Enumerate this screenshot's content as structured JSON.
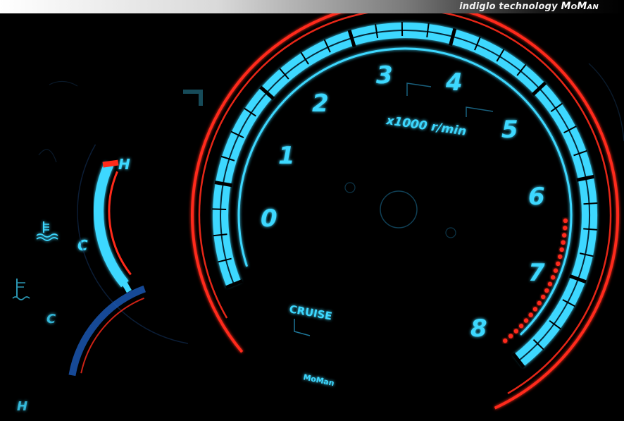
{
  "header": {
    "tagline": "indiglo technology",
    "brand": "MoMan"
  },
  "tachometer": {
    "numbers": [
      "0",
      "1",
      "2",
      "3",
      "4",
      "5",
      "6",
      "7",
      "8"
    ],
    "unit_label": "x1000 r/min",
    "cruise_label": "CRUISE",
    "brand_mark": "MoMan"
  },
  "temp_gauge": {
    "hot_label": "H",
    "cold_label": "C"
  },
  "fuel_gauge": {
    "cold_label": "C",
    "hot_label": "H"
  },
  "colors": {
    "backlight": "#3ed8ff",
    "redline": "#ff2a1a",
    "background": "#000000"
  },
  "icons": [
    "coolant-temp-icon",
    "fuel-icon"
  ]
}
